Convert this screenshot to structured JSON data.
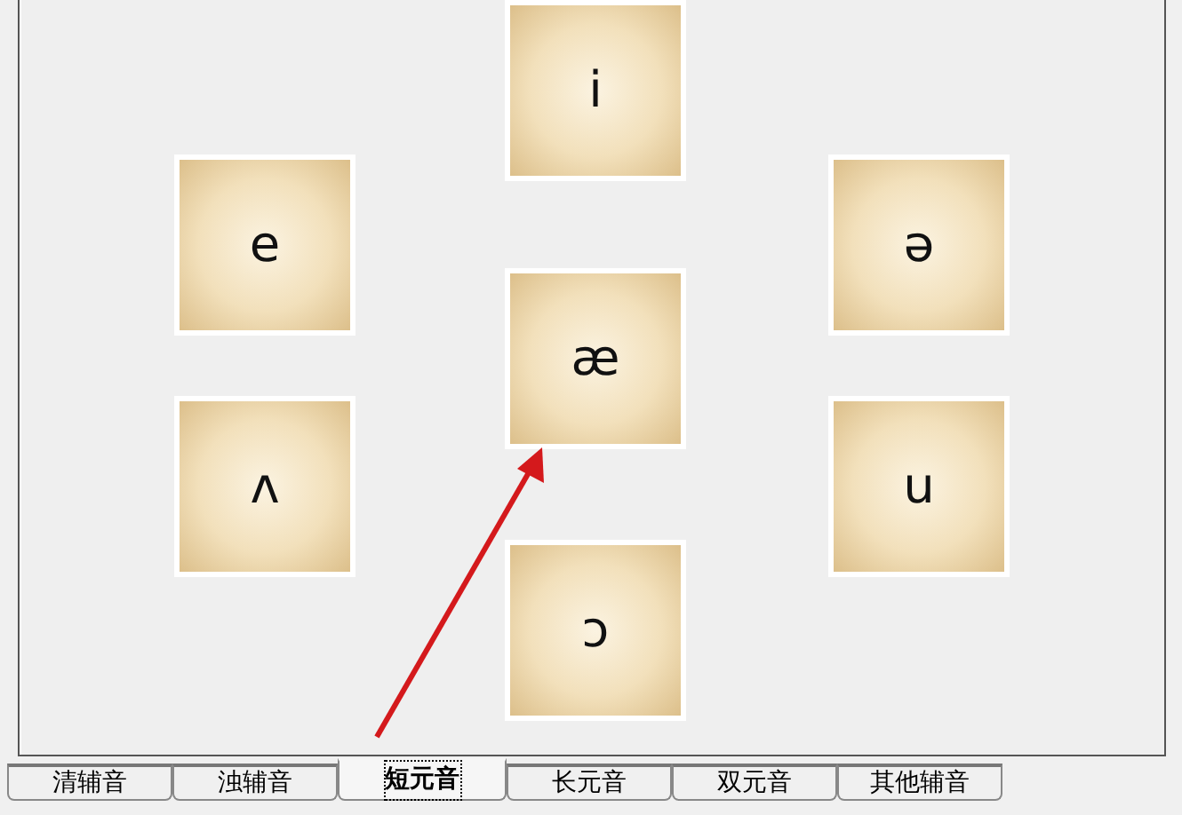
{
  "cards": [
    {
      "symbol": "i"
    },
    {
      "symbol": "e"
    },
    {
      "symbol": "ə"
    },
    {
      "symbol": "æ"
    },
    {
      "symbol": "ʌ"
    },
    {
      "symbol": "u"
    },
    {
      "symbol": "ɔ"
    }
  ],
  "tabs": [
    {
      "label": "清辅音",
      "selected": false
    },
    {
      "label": "浊辅音",
      "selected": false
    },
    {
      "label": "短元音",
      "selected": true
    },
    {
      "label": "长元音",
      "selected": false
    },
    {
      "label": "双元音",
      "selected": false
    },
    {
      "label": "其他辅音",
      "selected": false
    }
  ]
}
